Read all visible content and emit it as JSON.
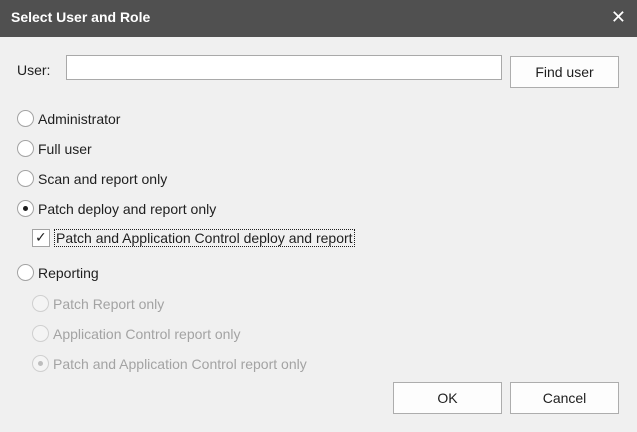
{
  "window": {
    "title": "Select User and Role",
    "close_glyph": "✕"
  },
  "user": {
    "label": "User:",
    "value": "",
    "find_button": "Find user"
  },
  "roles": [
    {
      "label": "Administrator",
      "selected": false
    },
    {
      "label": "Full user",
      "selected": false
    },
    {
      "label": "Scan and report only",
      "selected": false
    },
    {
      "label": "Patch deploy and report only",
      "selected": true
    },
    {
      "label": "Reporting",
      "selected": false
    }
  ],
  "patch_option": {
    "label": "Patch and Application Control deploy and report",
    "checked": true,
    "check_glyph": "✓"
  },
  "reporting_options": [
    {
      "label": "Patch Report only",
      "selected": false,
      "enabled": false
    },
    {
      "label": "Application Control report only",
      "selected": false,
      "enabled": false
    },
    {
      "label": "Patch and Application Control report only",
      "selected": true,
      "enabled": false
    }
  ],
  "buttons": {
    "ok": "OK",
    "cancel": "Cancel"
  }
}
